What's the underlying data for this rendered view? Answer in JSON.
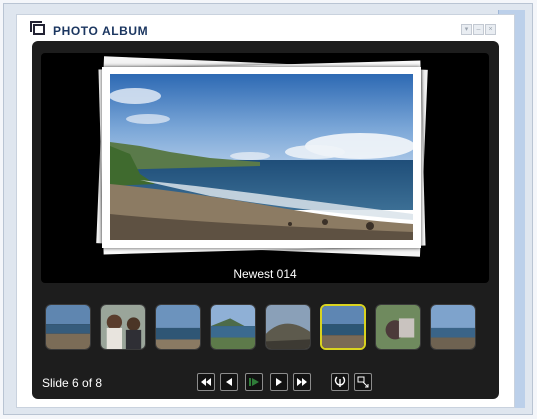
{
  "window": {
    "title": "PHOTO ALBUM"
  },
  "window_buttons": [
    "▾",
    "–",
    "×"
  ],
  "slide": {
    "caption": "Newest 014"
  },
  "status": {
    "text": "Slide 6 of 8"
  },
  "thumbnails": [
    {
      "label": "thumbnail 1",
      "selected": false
    },
    {
      "label": "thumbnail 2",
      "selected": false
    },
    {
      "label": "thumbnail 3",
      "selected": false
    },
    {
      "label": "thumbnail 4",
      "selected": false
    },
    {
      "label": "thumbnail 5",
      "selected": false
    },
    {
      "label": "thumbnail 6",
      "selected": true
    },
    {
      "label": "thumbnail 7",
      "selected": false
    },
    {
      "label": "thumbnail 8",
      "selected": false
    }
  ],
  "controls": [
    "first-icon",
    "previous-icon",
    "play-icon",
    "next-icon",
    "last-icon",
    "settings-icon",
    "fullscreen-icon"
  ],
  "colors": {
    "album_bg": "#1d1d1d",
    "selected_border": "#d9d31f",
    "title": "#1b3660"
  }
}
